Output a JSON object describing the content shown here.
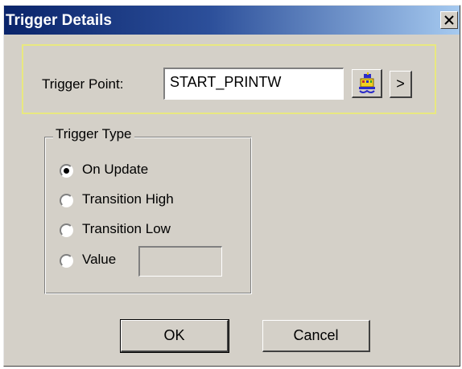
{
  "window": {
    "title": "Trigger Details",
    "close_label": "X"
  },
  "trigger_point": {
    "label": "Trigger Point:",
    "value": "START_PRINTW",
    "browse_icon": "point-browser-icon",
    "more_label": ">"
  },
  "trigger_type": {
    "legend": "Trigger Type",
    "options": [
      {
        "label": "On Update",
        "selected": true
      },
      {
        "label": "Transition High",
        "selected": false
      },
      {
        "label": "Transition Low",
        "selected": false
      },
      {
        "label": "Value",
        "selected": false
      }
    ],
    "value_field": ""
  },
  "buttons": {
    "ok": "OK",
    "cancel": "Cancel"
  },
  "colors": {
    "title_bar_start": "#0a246a",
    "title_bar_end": "#a6caf0",
    "dialog_face": "#d4d0c8",
    "highlight_border": "#e8e880"
  }
}
